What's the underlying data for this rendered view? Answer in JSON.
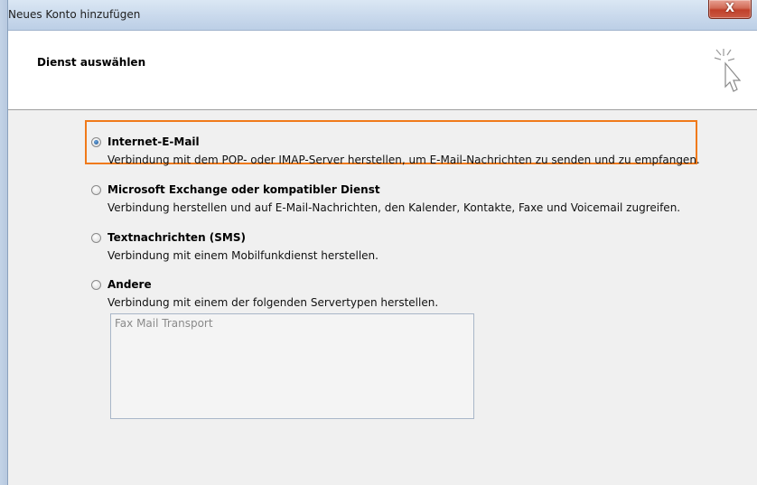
{
  "window": {
    "title": "Neues Konto hinzufügen",
    "close_label": "X"
  },
  "header": {
    "section_title": "Dienst auswählen"
  },
  "options": [
    {
      "label": "Internet-E-Mail",
      "description": "Verbindung mit dem POP- oder IMAP-Server herstellen, um E-Mail-Nachrichten zu senden und zu empfangen.",
      "selected": true
    },
    {
      "label": "Microsoft Exchange oder kompatibler Dienst",
      "description": "Verbindung herstellen und auf E-Mail-Nachrichten, den Kalender, Kontakte, Faxe und Voicemail zugreifen.",
      "selected": false
    },
    {
      "label": "Textnachrichten (SMS)",
      "description": "Verbindung mit einem Mobilfunkdienst herstellen.",
      "selected": false
    },
    {
      "label": "Andere",
      "description": "Verbindung mit einem der folgenden Servertypen herstellen.",
      "selected": false
    }
  ],
  "server_types": [
    "Fax Mail Transport"
  ],
  "colors": {
    "highlight": "#f07a1a",
    "close_button": "#c0402a"
  }
}
